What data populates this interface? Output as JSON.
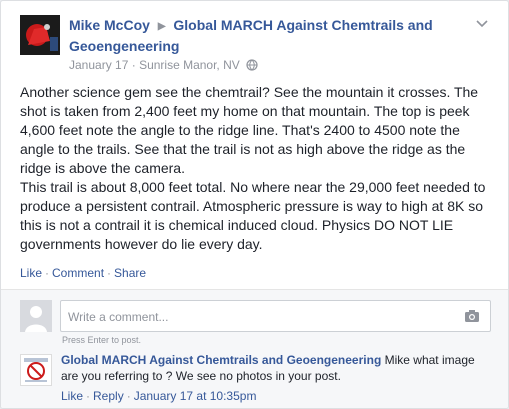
{
  "post": {
    "author": "Mike McCoy",
    "group": "Global MARCH Against Chemtrails and Geoengeneering",
    "date": "January 17",
    "location": "Sunrise Manor, NV",
    "text": "Another science gem see the chemtrail? See the mountain it crosses. The shot is taken from 2,400 feet my home on that mountain. The top is peek 4,600 feet note the angle to the ridge line. That's 2400 to 4500 note the angle to the trails. See that the trail is not as high above the ridge as the ridge is above the camera.\nThis trail is about 8,000 feet total. No where near the 29,000 feet needed to produce a persistent contrail. Atmospheric pressure is way to high at 8K so this is not a contrail it is chemical induced cloud. Physics DO NOT LIE governments however do lie every day.",
    "actions": {
      "like": "Like",
      "comment": "Comment",
      "share": "Share"
    }
  },
  "comment_input": {
    "placeholder": "Write a comment...",
    "hint": "Press Enter to post."
  },
  "reply": {
    "author": "Global MARCH Against Chemtrails and Geoengeneering",
    "text": "Mike what image are you referring to ? We see no photos in your post.",
    "like": "Like",
    "reply": "Reply",
    "timestamp": "January 17 at 10:35pm"
  },
  "colors": {
    "link_blue": "#365899",
    "meta_gray": "#90949c",
    "text": "#1d2129"
  },
  "icons": [
    "globe-icon",
    "chevron-down-icon",
    "camera-icon"
  ]
}
